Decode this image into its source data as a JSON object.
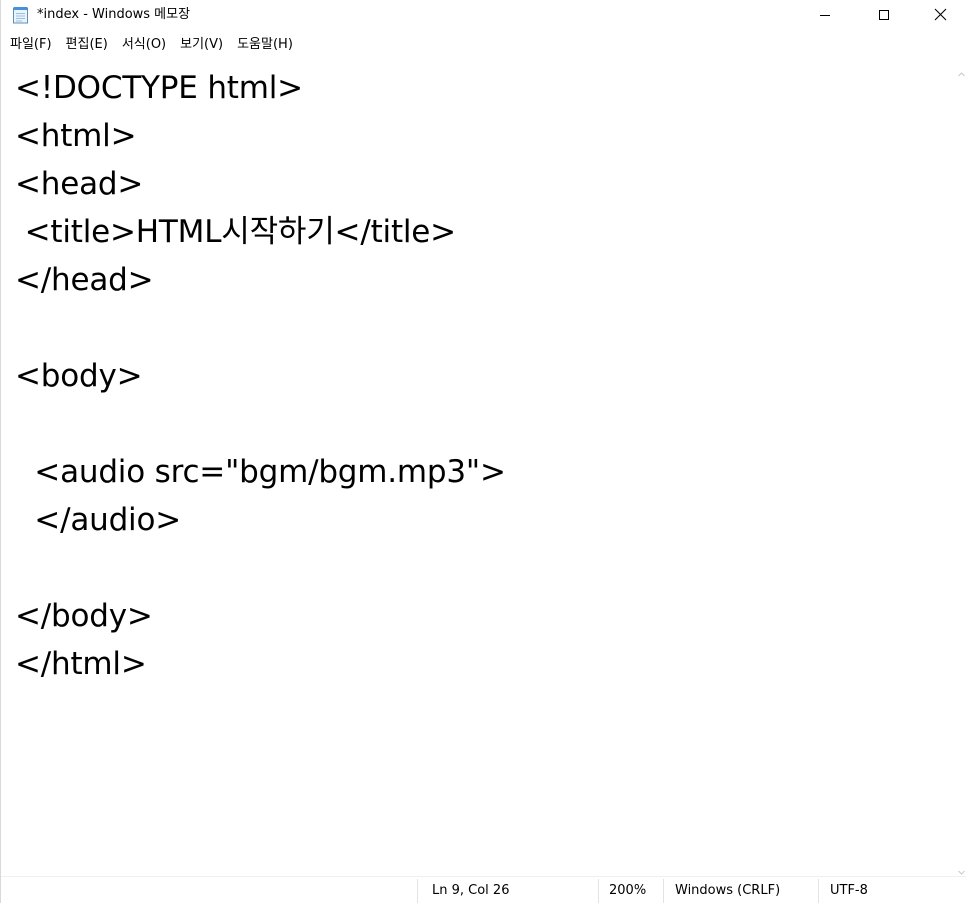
{
  "window": {
    "title": "*index - Windows 메모장",
    "icon": "notepad-icon"
  },
  "caption_buttons": {
    "minimize": "minimize-icon",
    "maximize": "maximize-icon",
    "close": "close-icon"
  },
  "menu": {
    "items": [
      {
        "label": "파일(F)"
      },
      {
        "label": "편집(E)"
      },
      {
        "label": "서식(O)"
      },
      {
        "label": "보기(V)"
      },
      {
        "label": "도움말(H)"
      }
    ]
  },
  "editor": {
    "lines": [
      "<!DOCTYPE html>",
      "<html>",
      "<head>",
      " <title>HTML시작하기</title>",
      "</head>",
      "",
      "<body>",
      "",
      "  <audio src=\"bgm/bgm.mp3\">",
      "  </audio>",
      "",
      "</body>",
      "</html>"
    ]
  },
  "status": {
    "position": "Ln 9, Col 26",
    "zoom": "200%",
    "line_ending": "Windows (CRLF)",
    "encoding": "UTF-8"
  }
}
